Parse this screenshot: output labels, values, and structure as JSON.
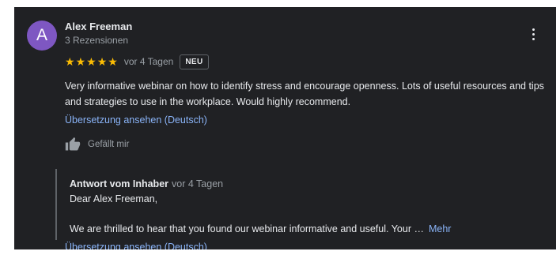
{
  "review": {
    "author": {
      "name": "Alex Freeman",
      "initial": "A",
      "review_count": "3 Rezensionen",
      "avatar_color": "#7e57c2"
    },
    "rating": 5,
    "max_rating": 5,
    "star_color": "#fbbc04",
    "date": "vor 4 Tagen",
    "badge": "NEU",
    "text": "Very informative webinar on how to identify stress and encourage openness. Lots of useful resources and tips and strategies to use in the workplace. Would highly recommend.",
    "translate_label": "Übersetzung ansehen (Deutsch)",
    "like_label": "Gefällt mir",
    "menu_icon": "more-vert-icon",
    "like_icon": "thumbs-up-icon"
  },
  "reply": {
    "owner_label": "Antwort vom Inhaber",
    "date": "vor 4 Tagen",
    "greeting": "Dear Alex Freeman,",
    "body": "We are thrilled to hear that you found our webinar informative and useful. Your …",
    "more_label": "Mehr",
    "translate_label": "Übersetzung ansehen (Deutsch)"
  },
  "theme": {
    "background": "#202124",
    "link_color": "#8ab4f8",
    "text_color": "#e8eaed",
    "muted_color": "#9aa0a6"
  }
}
